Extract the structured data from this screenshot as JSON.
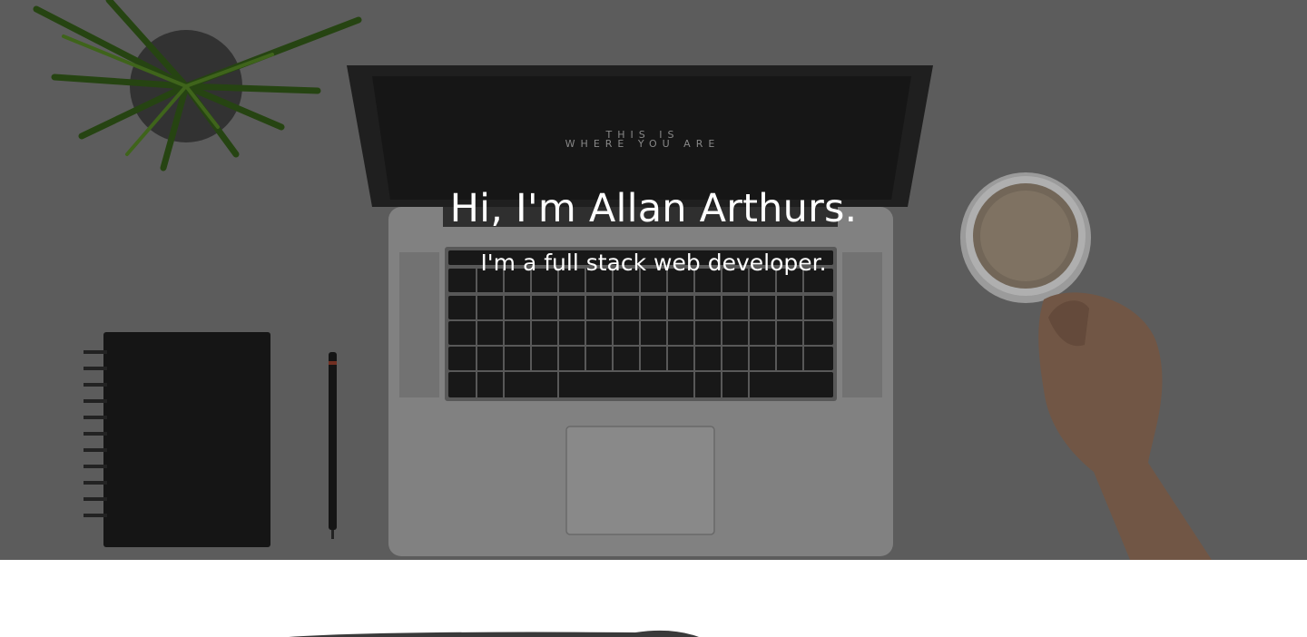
{
  "hero": {
    "title": "Hi, I'm Allan Arthurs.",
    "subtitle": "I'm a full stack web developer.",
    "screen_line1": "THIS IS",
    "screen_line2": "WHERE YOU ARE"
  },
  "colors": {
    "hero_overlay": "#6f6f6f",
    "text": "#ffffff",
    "page_background": "#ffffff"
  },
  "icons": [
    "plant-icon",
    "notebook-icon",
    "pen-icon",
    "laptop-icon",
    "coffee-cup-icon",
    "hand-icon"
  ]
}
